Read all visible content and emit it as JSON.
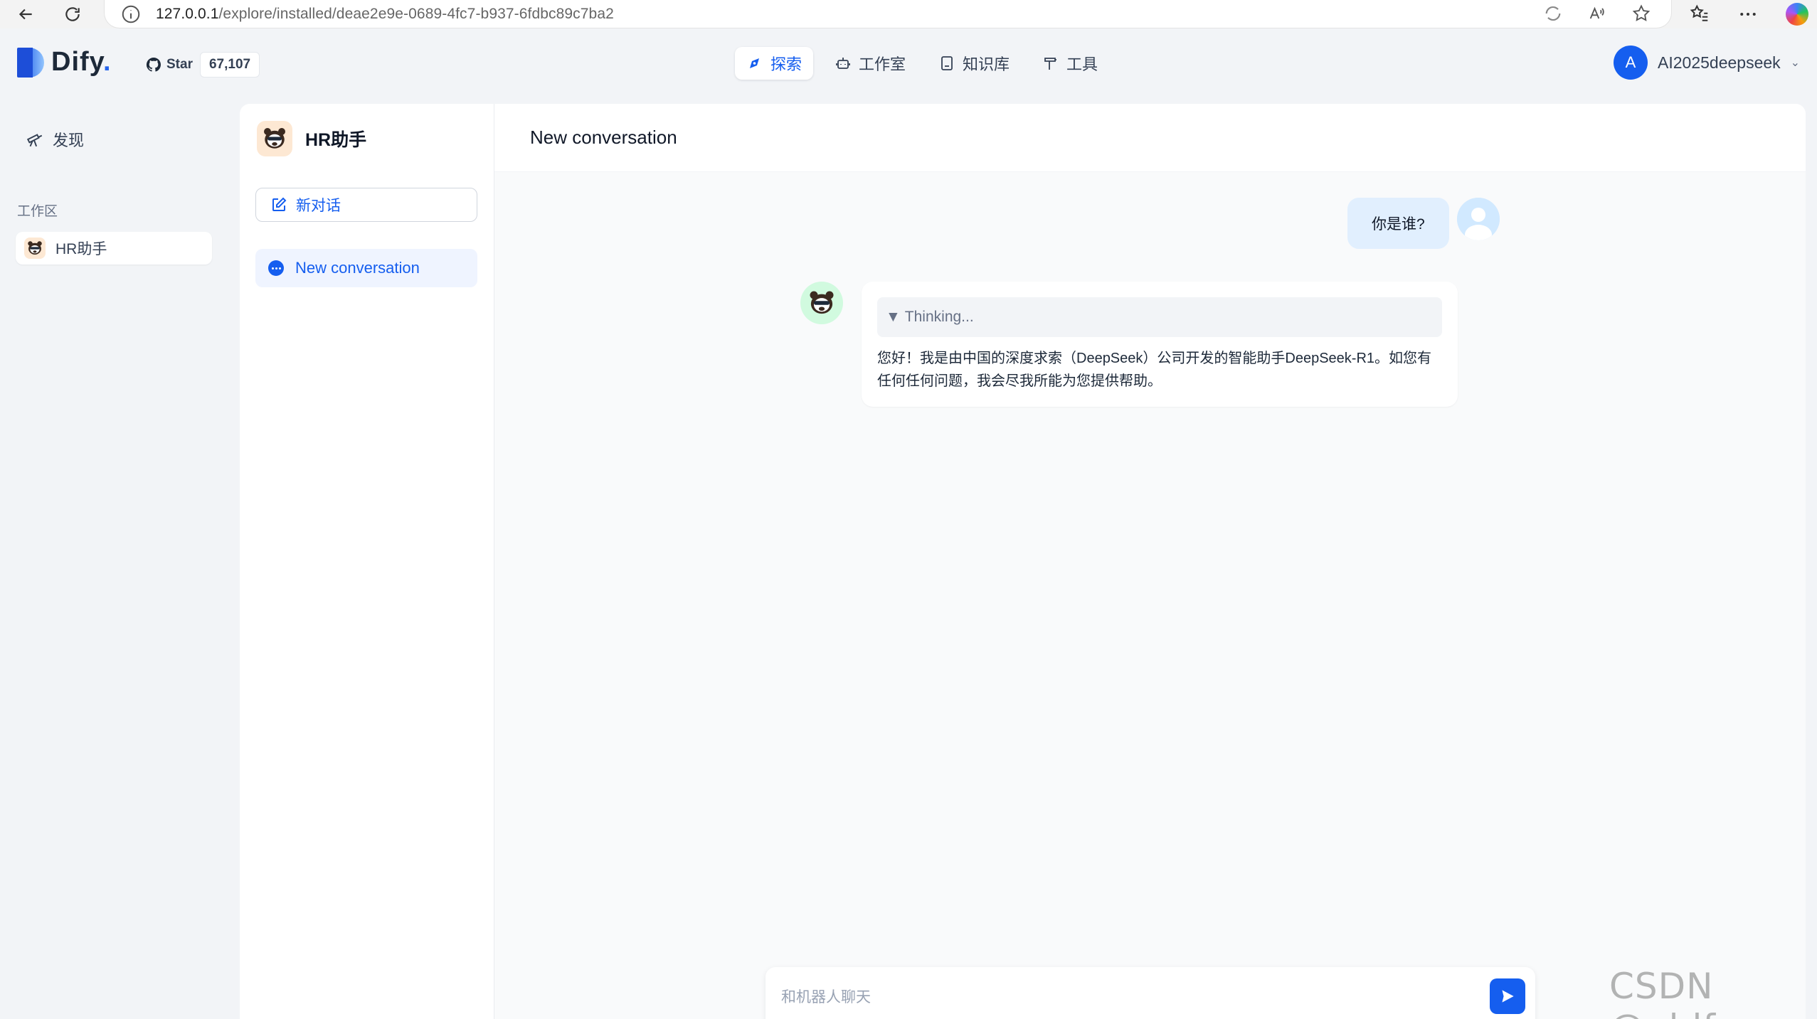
{
  "browser": {
    "url_host": "127.0.0.1",
    "url_path": "/explore/installed/deae2e9e-0689-4fc7-b937-6fdbc89c7ba2"
  },
  "header": {
    "logo_text": "Dify",
    "logo_dot": ".",
    "github_star_label": "Star",
    "github_star_count": "67,107",
    "nav": [
      {
        "label": "探索",
        "active": true
      },
      {
        "label": "工作室",
        "active": false
      },
      {
        "label": "知识库",
        "active": false
      },
      {
        "label": "工具",
        "active": false
      }
    ],
    "user_initial": "A",
    "username": "AI2025deepseek"
  },
  "sidebar": {
    "discover_label": "发现",
    "workspace_label": "工作区",
    "workspace_items": [
      {
        "label": "HR助手"
      }
    ]
  },
  "panel": {
    "app_name": "HR助手",
    "new_chat_label": "新对话",
    "conversations": [
      {
        "label": "New conversation",
        "active": true
      }
    ]
  },
  "chat": {
    "title": "New conversation",
    "user_message": "你是谁?",
    "thinking_label": "Thinking...",
    "bot_answer": "您好！我是由中国的深度求索（DeepSeek）公司开发的智能助手DeepSeek-R1。如您有任何任何问题，我会尽我所能为您提供帮助。",
    "input_placeholder": "和机器人聊天"
  },
  "watermark": "CSDN @gblfy",
  "colors": {
    "accent": "#155eef",
    "user_bubble": "#e1effe",
    "background": "#f2f4f7"
  }
}
